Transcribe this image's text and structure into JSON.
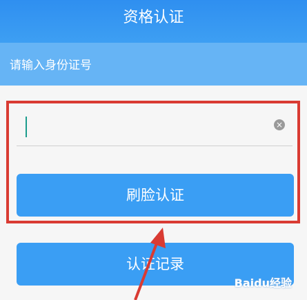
{
  "header": {
    "title": "资格认证"
  },
  "id_section": {
    "label": "请输入身份证号"
  },
  "input": {
    "value": ""
  },
  "buttons": {
    "face_auth": "刷脸认证",
    "records": "认证记录"
  },
  "watermark": {
    "text": "Baidu经验"
  },
  "colors": {
    "primary": "#3a9ef4",
    "header": "#2f8ff0",
    "highlight": "#d93b33"
  }
}
